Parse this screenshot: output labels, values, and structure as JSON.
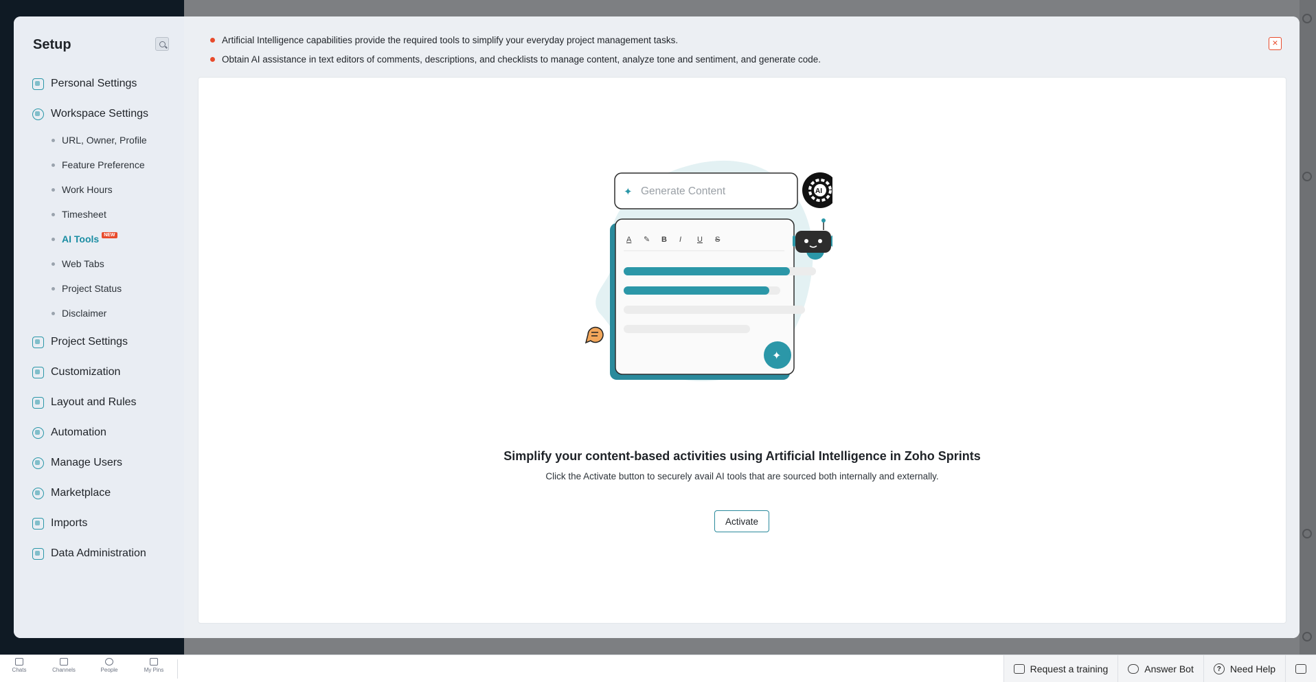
{
  "setup": {
    "title": "Setup",
    "personal_settings": "Personal Settings",
    "workspace_settings": "Workspace Settings",
    "workspace_sub": [
      "URL, Owner, Profile",
      "Feature Preference",
      "Work Hours",
      "Timesheet",
      "AI Tools",
      "Web Tabs",
      "Project Status",
      "Disclaimer"
    ],
    "new_badge": "NEW",
    "project_settings": "Project Settings",
    "customization": "Customization",
    "layout_and_rules": "Layout and Rules",
    "automation": "Automation",
    "manage_users": "Manage Users",
    "marketplace": "Marketplace",
    "imports": "Imports",
    "data_administration": "Data Administration",
    "active_item": "AI Tools"
  },
  "ai_tools": {
    "bullets": [
      "Artificial Intelligence capabilities provide the required tools to simplify your everyday project management tasks.",
      "Obtain AI assistance in text editors of comments, descriptions, and checklists to manage content, analyze tone and sentiment, and generate code."
    ],
    "close_label": "×",
    "illustration": {
      "generate_placeholder": "Generate Content",
      "ai_badge": "AI",
      "toolbar": [
        "A",
        "✎",
        "B",
        "I",
        "U",
        "S"
      ]
    },
    "headline": "Simplify your content-based activities using Artificial Intelligence in Zoho Sprints",
    "subtext": "Click the Activate button to securely avail AI tools that are sourced both internally and externally.",
    "activate_label": "Activate"
  },
  "bottom_bar": {
    "nav": [
      "Chats",
      "Channels",
      "People",
      "My Pins"
    ],
    "request_training": "Request a training",
    "answer_bot": "Answer Bot",
    "need_help": "Need Help"
  },
  "colors": {
    "accent": "#2b97a8",
    "bullet": "#e84b2c",
    "sidebar_bg": "#e9edf3"
  }
}
